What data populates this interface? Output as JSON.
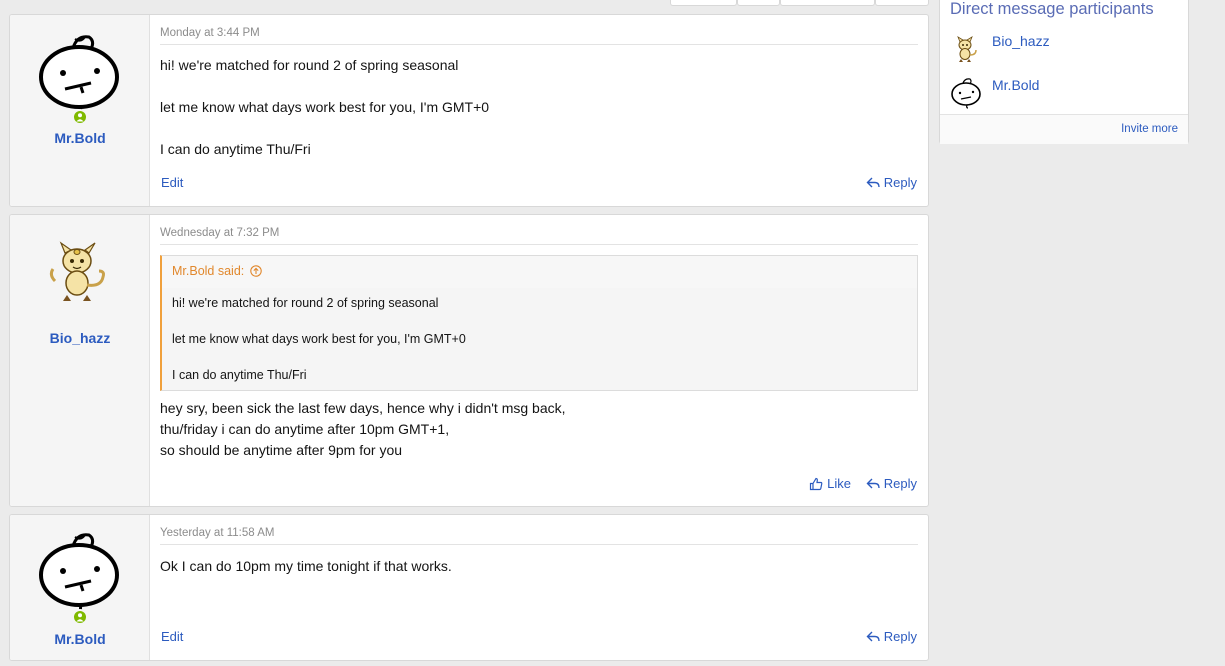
{
  "sidebar": {
    "title": "Direct message participants",
    "participants": [
      {
        "name": "Bio_hazz",
        "avatar": "meowth-avatar"
      },
      {
        "name": "Mr.Bold",
        "avatar": "doodle-face-avatar"
      }
    ],
    "invite_label": "Invite more"
  },
  "messages": [
    {
      "author": "Mr.Bold",
      "date": "Monday at 3:44 PM",
      "body": [
        "hi! we're matched for round 2 of spring seasonal",
        "let me know what days work best for you, I'm GMT+0",
        "I can do anytime Thu/Fri"
      ],
      "edit_label": "Edit",
      "reply_label": "Reply"
    },
    {
      "author": "Bio_hazz",
      "date": "Wednesday at 7:32 PM",
      "quote": {
        "author": "Mr.Bold said:",
        "lines": [
          "hi! we're matched for round 2 of spring seasonal",
          "let me know what days work best for you, I'm GMT+0",
          "I can do anytime Thu/Fri"
        ]
      },
      "body": [
        "hey sry, been sick the last few days, hence why i didn't msg back,",
        "thu/friday i can do anytime after 10pm GMT+1,",
        "so should be anytime after 9pm for you"
      ],
      "like_label": "Like",
      "reply_label": "Reply"
    },
    {
      "author": "Mr.Bold",
      "date": "Yesterday at 11:58 AM",
      "body": [
        "Ok I can do 10pm my time tonight if that works."
      ],
      "edit_label": "Edit",
      "reply_label": "Reply"
    }
  ],
  "colors": {
    "link": "#2c5bbf",
    "quote_accent": "#e1882d",
    "online": "#7fb900"
  }
}
